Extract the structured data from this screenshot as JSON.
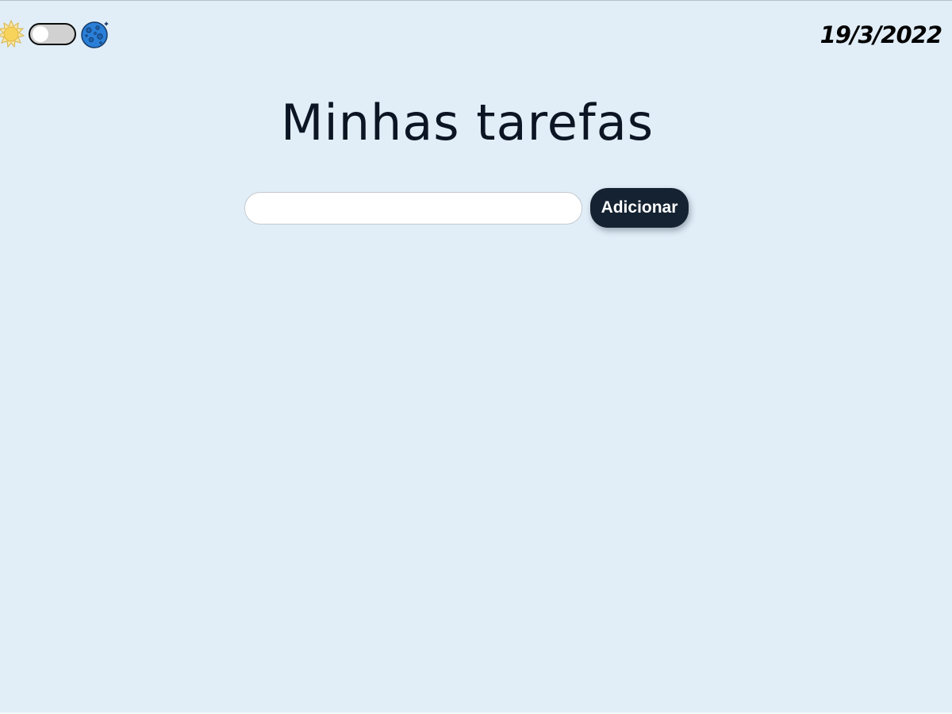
{
  "header": {
    "theme_toggle": {
      "state": "light",
      "sun_icon": "sun-icon",
      "moon_icon": "moon-icon"
    },
    "date": "19/3/2022"
  },
  "main": {
    "title": "Minhas tarefas",
    "task_input": {
      "value": "",
      "placeholder": ""
    },
    "add_button_label": "Adicionar"
  },
  "colors": {
    "background": "#e1eef8",
    "button": "#142231",
    "title_text": "#0c1524",
    "sun": "#f7d35c",
    "moon": "#2a7fd8"
  }
}
